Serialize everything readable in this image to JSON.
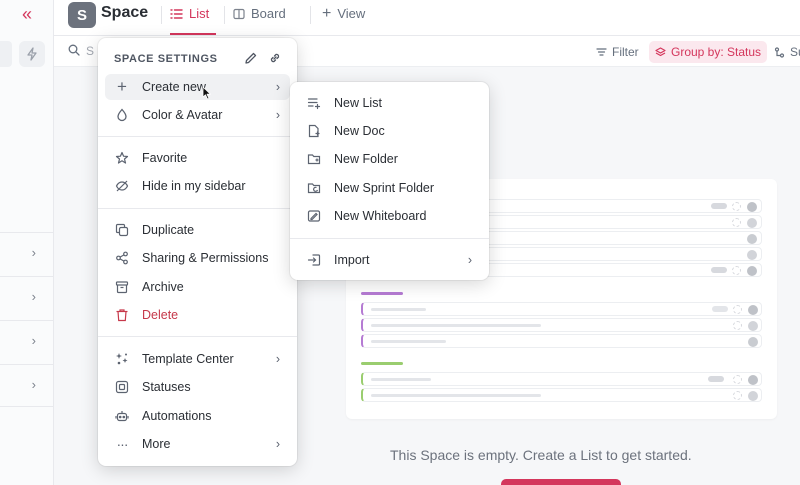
{
  "header": {
    "space_initial": "S",
    "space_name": "Space",
    "tabs": [
      {
        "label": "List",
        "icon": "list-icon",
        "active": true
      },
      {
        "label": "Board",
        "icon": "board-icon",
        "active": false
      },
      {
        "label": "View",
        "icon": "plus-icon",
        "active": false
      }
    ]
  },
  "toolbar": {
    "search_text": "S",
    "filter_label": "Filter",
    "group_label": "Group by: Status",
    "subtasks_label": "Su"
  },
  "settings_menu": {
    "title": "SPACE SETTINGS",
    "sections": [
      [
        {
          "label": "Create new",
          "icon": "plus-icon",
          "submenu": true,
          "hover": true
        },
        {
          "label": "Color & Avatar",
          "icon": "droplet-icon",
          "submenu": true
        }
      ],
      [
        {
          "label": "Favorite",
          "icon": "star-icon"
        },
        {
          "label": "Hide in my sidebar",
          "icon": "eye-off-icon"
        }
      ],
      [
        {
          "label": "Duplicate",
          "icon": "copy-icon"
        },
        {
          "label": "Sharing & Permissions",
          "icon": "share-icon"
        },
        {
          "label": "Archive",
          "icon": "archive-icon"
        },
        {
          "label": "Delete",
          "icon": "trash-icon",
          "danger": true
        }
      ],
      [
        {
          "label": "Template Center",
          "icon": "template-icon",
          "submenu": true
        },
        {
          "label": "Statuses",
          "icon": "status-icon"
        },
        {
          "label": "Automations",
          "icon": "robot-icon"
        },
        {
          "label": "More",
          "icon": "dots-icon",
          "submenu": true
        }
      ]
    ]
  },
  "create_submenu": {
    "items": [
      {
        "label": "New List",
        "icon": "new-list-icon"
      },
      {
        "label": "New Doc",
        "icon": "new-doc-icon"
      },
      {
        "label": "New Folder",
        "icon": "new-folder-icon"
      },
      {
        "label": "New Sprint Folder",
        "icon": "sprint-folder-icon"
      },
      {
        "label": "New Whiteboard",
        "icon": "whiteboard-icon"
      }
    ],
    "import_label": "Import"
  },
  "main": {
    "empty_message": "This Space is empty. Create a List to get started."
  },
  "colors": {
    "accent": "#d4365c",
    "purple_group": "#b57bd3",
    "green_group": "#9acd6f"
  }
}
